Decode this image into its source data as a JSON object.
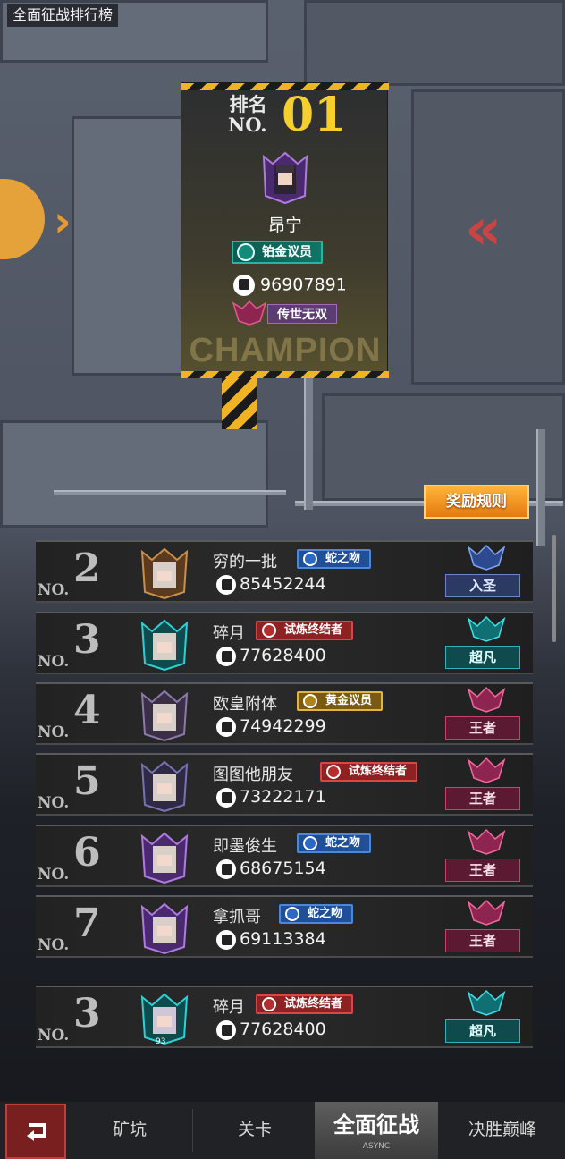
{
  "header": {
    "title": "全面征战排行榜"
  },
  "champion": {
    "rank_label_1": "排名",
    "rank_label_2": "NO.",
    "rank_number": "01",
    "name": "昂宁",
    "title_badge": "铂金议员",
    "power": "96907891",
    "seal": "传世无双",
    "banner": "CHAMPION"
  },
  "reward_button": "奖励规则",
  "rows": [
    {
      "rank": "2",
      "name": "穷的一批",
      "badge": "蛇之吻",
      "badge_color": "#2d68c4",
      "power": "85452244",
      "tier": "入圣"
    },
    {
      "rank": "3",
      "name": "碎月",
      "badge": "试炼终结者",
      "badge_color": "#b52e2e",
      "power": "77628400",
      "tier": "超凡"
    },
    {
      "rank": "4",
      "name": "欧皇附体",
      "badge": "黄金议员",
      "badge_color": "#b08318",
      "power": "74942299",
      "tier": "王者"
    },
    {
      "rank": "5",
      "name": "图图他朋友",
      "badge": "试炼终结者",
      "badge_color": "#b52e2e",
      "power": "73222171",
      "tier": "王者"
    },
    {
      "rank": "6",
      "name": "即墨俊生",
      "badge": "蛇之吻",
      "badge_color": "#2d68c4",
      "power": "68675154",
      "tier": "王者"
    },
    {
      "rank": "7",
      "name": "拿抓哥",
      "badge": "蛇之吻",
      "badge_color": "#2d68c4",
      "power": "69113384",
      "tier": "王者"
    }
  ],
  "self_row": {
    "rank": "3",
    "name": "碎月",
    "badge": "试炼终结者",
    "power": "77628400",
    "tier": "超凡",
    "avatar_level": "93"
  },
  "row_label": "NO.",
  "nav": {
    "back_icon": "back-arrow-icon",
    "tabs": [
      {
        "label": "矿坑"
      },
      {
        "label": "关卡"
      },
      {
        "label": "全面征战",
        "sub": "ASYNC"
      },
      {
        "label": "决胜巅峰"
      }
    ]
  }
}
